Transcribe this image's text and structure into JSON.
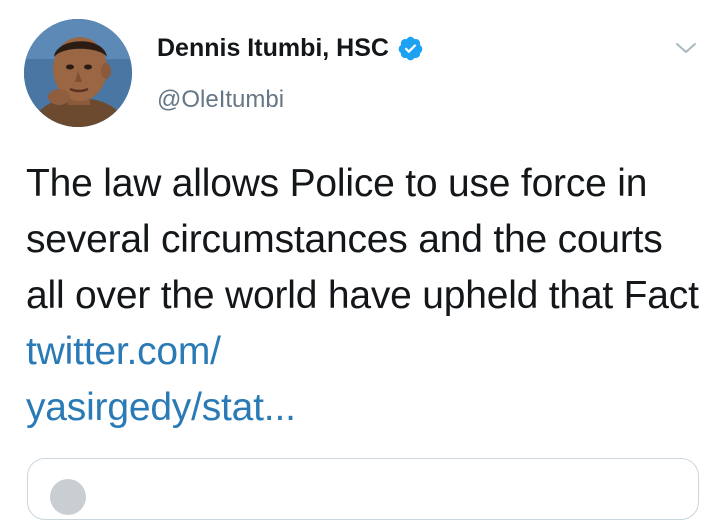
{
  "author": {
    "name": "Dennis Itumbi, HSC",
    "handle": "@OleItumbi",
    "verified": true
  },
  "tweet": {
    "text": "The law allows Police to use force in several circumstances and the courts all over the world have upheld that Fact ",
    "link_line1": "twitter.com/",
    "link_line2": "yasirgedy/stat..."
  },
  "icons": {
    "verified": "verified-badge-icon",
    "menu": "chevron-down-icon"
  },
  "colors": {
    "link": "#2a7ab5",
    "verified": "#1da1f2",
    "handle": "#657786",
    "text": "#14171a"
  }
}
